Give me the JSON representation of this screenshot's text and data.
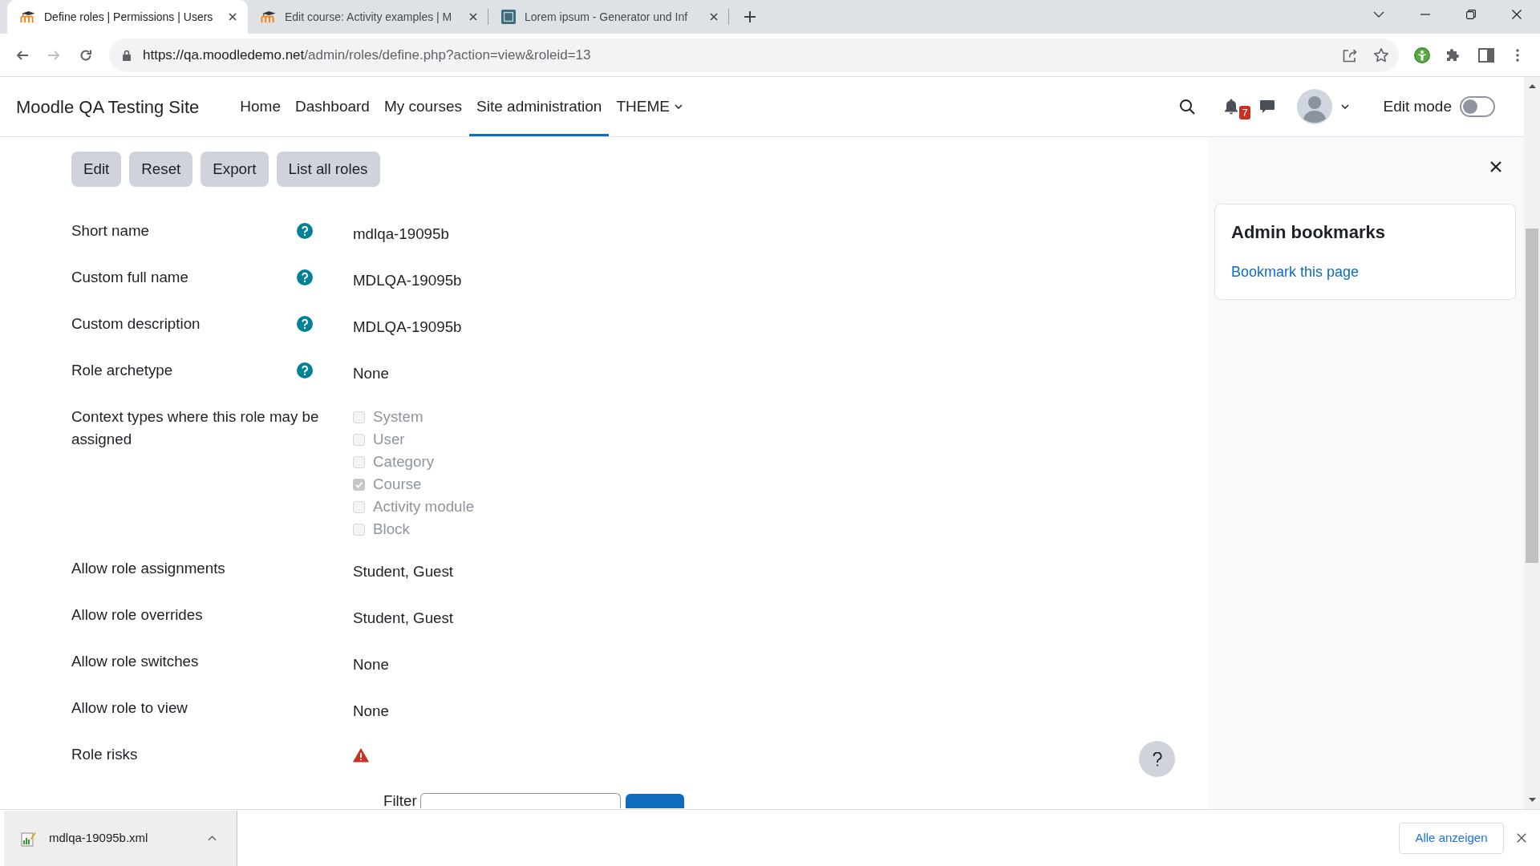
{
  "browser": {
    "tabs": [
      {
        "title": "Define roles | Permissions | Users",
        "selected": true,
        "kind": "hat"
      },
      {
        "title": "Edit course: Activity examples | M",
        "selected": false,
        "kind": "hat"
      },
      {
        "title": "Lorem ipsum - Generator und Inf",
        "selected": false,
        "kind": "tile"
      }
    ],
    "address": {
      "host": "https://qa.moodledemo.net",
      "path": "/admin/roles/define.php?action=view&roleid=13"
    }
  },
  "site": {
    "name": "Moodle QA Testing Site",
    "nav": [
      {
        "label": "Home",
        "selected": false,
        "menu": false
      },
      {
        "label": "Dashboard",
        "selected": false,
        "menu": false
      },
      {
        "label": "My courses",
        "selected": false,
        "menu": false
      },
      {
        "label": "Site administration",
        "selected": true,
        "menu": false
      },
      {
        "label": "THEME",
        "selected": false,
        "menu": true
      }
    ]
  },
  "user_menu": {
    "notifications": "7",
    "edit_mode": {
      "label": "Edit mode",
      "on": false
    }
  },
  "actions": [
    "Edit",
    "Reset",
    "Export",
    "List all roles"
  ],
  "fields": [
    {
      "label": "Short name",
      "help": true,
      "kind": "text",
      "value": "mdlqa-19095b"
    },
    {
      "label": "Custom full name",
      "help": true,
      "kind": "text",
      "value": "MDLQA-19095b"
    },
    {
      "label": "Custom description",
      "help": true,
      "kind": "text",
      "value": "MDLQA-19095b"
    },
    {
      "label": "Role archetype",
      "help": true,
      "kind": "text",
      "value": "None"
    },
    {
      "label": "Context types where this role may be assigned",
      "help": false,
      "kind": "checkboxes",
      "options": [
        {
          "label": "System",
          "checked": false,
          "disabled": true
        },
        {
          "label": "User",
          "checked": false,
          "disabled": true
        },
        {
          "label": "Category",
          "checked": false,
          "disabled": true
        },
        {
          "label": "Course",
          "checked": true,
          "disabled": true
        },
        {
          "label": "Activity module",
          "checked": false,
          "disabled": true
        },
        {
          "label": "Block",
          "checked": false,
          "disabled": true
        }
      ]
    },
    {
      "label": "Allow role assignments",
      "help": false,
      "kind": "text",
      "value": "Student, Guest"
    },
    {
      "label": "Allow role overrides",
      "help": false,
      "kind": "text",
      "value": "Student, Guest"
    },
    {
      "label": "Allow role switches",
      "help": false,
      "kind": "text",
      "value": "None"
    },
    {
      "label": "Allow role to view",
      "help": false,
      "kind": "text",
      "value": "None"
    },
    {
      "label": "Role risks",
      "help": false,
      "kind": "risks"
    }
  ],
  "filter": {
    "label": "Filter"
  },
  "drawer": {
    "blocks": [
      {
        "title": "Admin bookmarks",
        "links": [
          "Bookmark this page"
        ]
      }
    ]
  },
  "downloads": {
    "items": [
      {
        "filename": "mdlqa-19095b.xml"
      }
    ],
    "show_all": "Alle anzeigen"
  }
}
